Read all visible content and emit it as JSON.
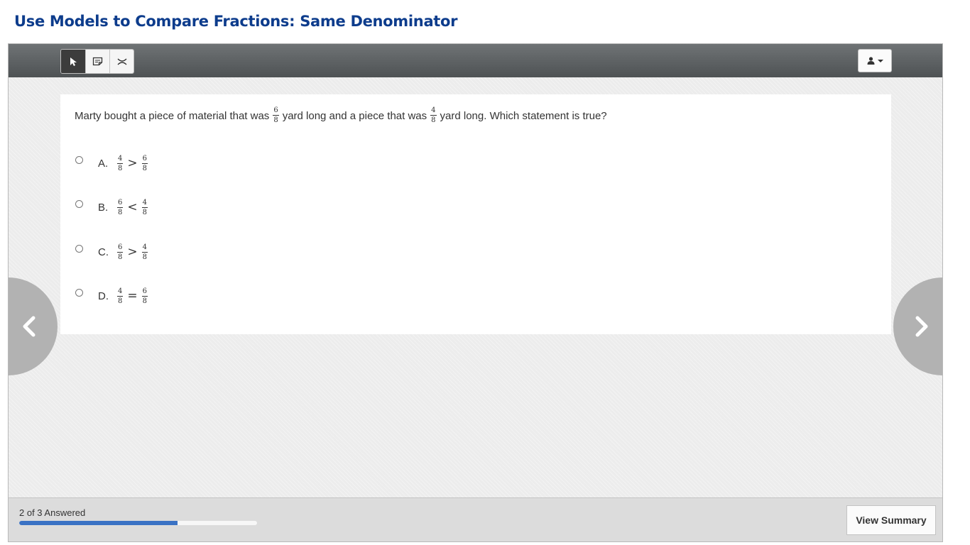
{
  "page": {
    "title": "Use Models to Compare Fractions: Same Denominator"
  },
  "toolbar": {
    "tools": [
      {
        "name": "pointer",
        "icon": "pointer-icon",
        "active": true
      },
      {
        "name": "note",
        "icon": "note-icon",
        "active": false
      },
      {
        "name": "eliminate",
        "icon": "strikethrough-icon",
        "active": false
      }
    ],
    "user_menu_icon": "user-icon"
  },
  "question": {
    "text_parts": [
      "Marty bought a piece of material that was",
      "yard long and a piece that was",
      "yard long. Which statement is true?"
    ],
    "fraction_1": {
      "num": "6",
      "den": "8"
    },
    "fraction_2": {
      "num": "4",
      "den": "8"
    },
    "choices": [
      {
        "letter": "A.",
        "left": {
          "num": "4",
          "den": "8"
        },
        "op": ">",
        "right": {
          "num": "6",
          "den": "8"
        }
      },
      {
        "letter": "B.",
        "left": {
          "num": "6",
          "den": "8"
        },
        "op": "<",
        "right": {
          "num": "4",
          "den": "8"
        }
      },
      {
        "letter": "C.",
        "left": {
          "num": "6",
          "den": "8"
        },
        "op": ">",
        "right": {
          "num": "4",
          "den": "8"
        }
      },
      {
        "letter": "D.",
        "left": {
          "num": "4",
          "den": "8"
        },
        "op": "=",
        "right": {
          "num": "6",
          "den": "8"
        }
      }
    ]
  },
  "navigation": {
    "prev_icon": "chevron-left-icon",
    "next_icon": "chevron-right-icon"
  },
  "footer": {
    "answered_text": "2 of 3 Answered",
    "progress_fraction": 0.667,
    "summary_label": "View Summary"
  },
  "colors": {
    "title": "#0d3c8c",
    "toolbar": "#5a5e60",
    "progress": "#3a72c4",
    "nav_arrow": "#b2b2b2"
  }
}
